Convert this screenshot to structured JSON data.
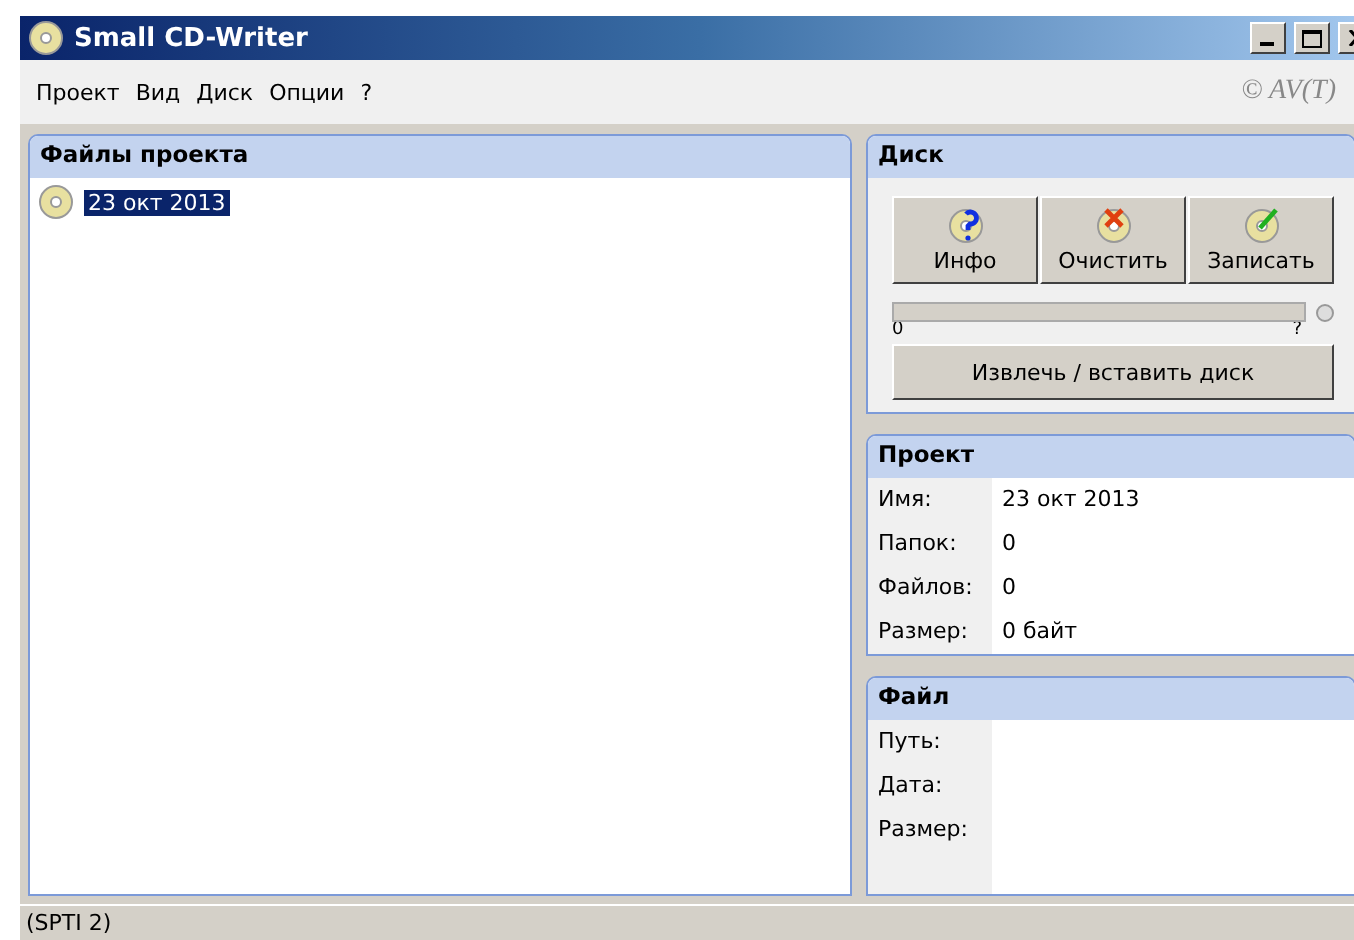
{
  "window": {
    "title": "Small CD-Writer"
  },
  "menu": {
    "items": [
      "Проект",
      "Вид",
      "Диск",
      "Опции",
      "?"
    ],
    "copyright": "© AV(T)"
  },
  "files_panel": {
    "title": "Файлы проекта",
    "items": [
      {
        "label": "23 окт 2013",
        "selected": true
      }
    ]
  },
  "disk_panel": {
    "title": "Диск",
    "buttons": [
      {
        "label": "Инфо",
        "kind": "info"
      },
      {
        "label": "Очистить",
        "kind": "erase"
      },
      {
        "label": "Записать",
        "kind": "write"
      }
    ],
    "progress": {
      "level": 0,
      "min_label": "0",
      "max_label": "?"
    },
    "eject_button": "Извлечь / вставить диск"
  },
  "project_panel": {
    "title": "Проект",
    "rows": [
      {
        "label": "Имя:",
        "value": "23 окт 2013"
      },
      {
        "label": "Папок:",
        "value": "0"
      },
      {
        "label": "Файлов:",
        "value": "0"
      },
      {
        "label": "Размер:",
        "value": "0 байт"
      }
    ]
  },
  "file_panel": {
    "title": "Файл",
    "rows": [
      {
        "label": "Путь:"
      },
      {
        "label": "Дата:"
      },
      {
        "label": "Размер:"
      }
    ]
  },
  "status_bar": "(SPTI 2)"
}
